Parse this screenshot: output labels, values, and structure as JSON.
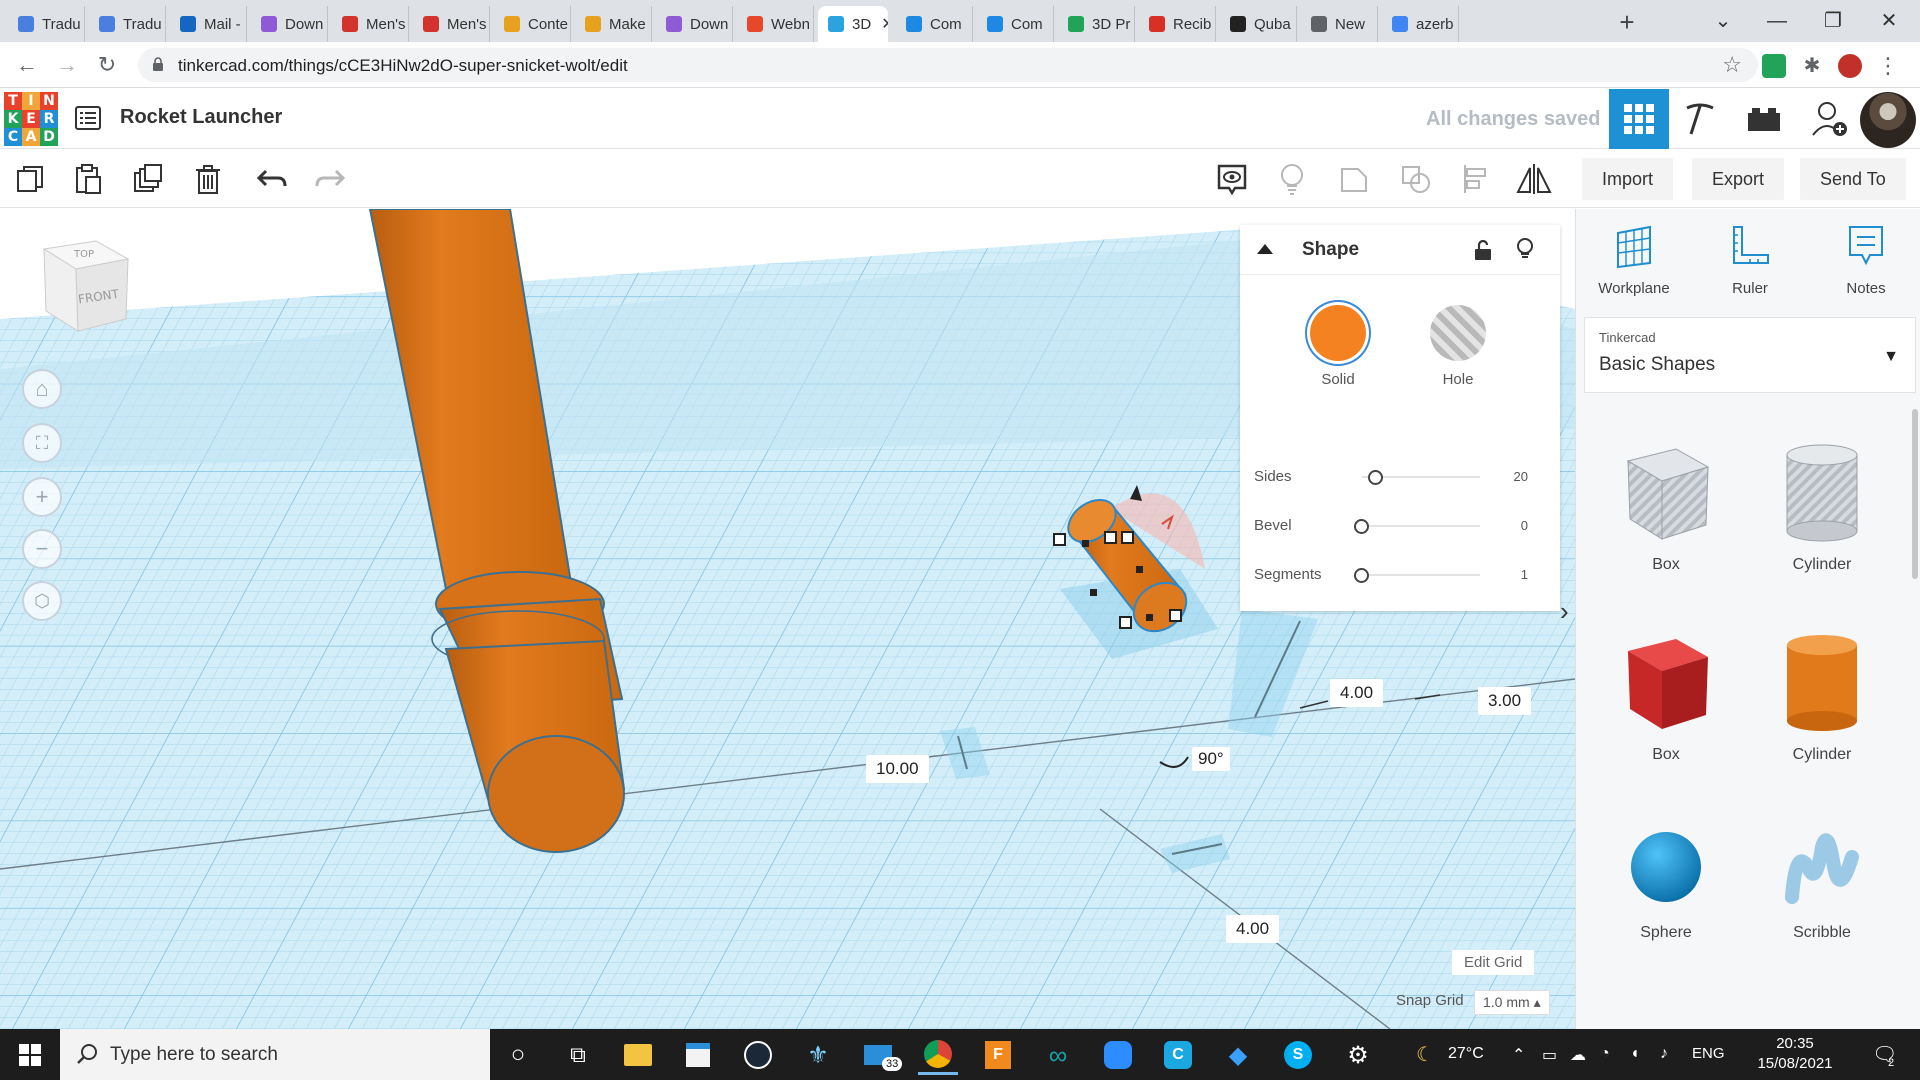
{
  "browser": {
    "tabs": [
      {
        "label": "Tradu",
        "color": "#4a7fe0"
      },
      {
        "label": "Tradu",
        "color": "#4a7fe0"
      },
      {
        "label": "Mail -",
        "color": "#1566c0"
      },
      {
        "label": "Down",
        "color": "#8e5bd6"
      },
      {
        "label": "Men's",
        "color": "#d4332d"
      },
      {
        "label": "Men's",
        "color": "#d4332d"
      },
      {
        "label": "Conte",
        "color": "#e6a21c"
      },
      {
        "label": "Make",
        "color": "#e6a21c"
      },
      {
        "label": "Down",
        "color": "#8e5bd6"
      },
      {
        "label": "Webn",
        "color": "#e8482a"
      },
      {
        "label": "3D",
        "color": "#2aa3e0",
        "active": true
      },
      {
        "label": "Com",
        "color": "#1e88e5"
      },
      {
        "label": "Com",
        "color": "#1e88e5"
      },
      {
        "label": "3D Pr",
        "color": "#22a35a"
      },
      {
        "label": "Recib",
        "color": "#d93025"
      },
      {
        "label": "Quba",
        "color": "#222222"
      },
      {
        "label": "New",
        "color": "#5f6368"
      },
      {
        "label": "azerb",
        "color": "#4285f4"
      }
    ],
    "url": "tinkercad.com/things/cCE3HiNw2dO-super-snicket-wolt/edit"
  },
  "header": {
    "logo_letters": [
      "T",
      "I",
      "N",
      "K",
      "E",
      "R",
      "C",
      "A",
      "D"
    ],
    "logo_colors": [
      "#e8412c",
      "#f2a63a",
      "#e8412c",
      "#22a35a",
      "#e8412c",
      "#1f8fd6",
      "#1f8fd6",
      "#f2a63a",
      "#22a35a"
    ],
    "project_title": "Rocket Launcher",
    "save_status": "All changes saved"
  },
  "toolbar": {
    "import": "Import",
    "export": "Export",
    "send_to": "Send To"
  },
  "viewcube": {
    "top": "TOP",
    "front": "FRONT"
  },
  "dimensions": {
    "height_value": "10.00",
    "width_value": "4.00",
    "depth_value": "3.00",
    "length_value": "4.00",
    "rotation": "90°"
  },
  "inspector": {
    "title": "Shape",
    "solid": "Solid",
    "hole": "Hole",
    "solid_color": "#f58220",
    "props": [
      {
        "name": "Sides",
        "value": "20"
      },
      {
        "name": "Bevel",
        "value": "0"
      },
      {
        "name": "Segments",
        "value": "1"
      }
    ]
  },
  "rightpanel": {
    "tools": [
      "Workplane",
      "Ruler",
      "Notes"
    ],
    "library_category": "Tinkercad",
    "library_name": "Basic Shapes",
    "shapes": [
      "Box",
      "Cylinder",
      "Box",
      "Cylinder",
      "Sphere",
      "Scribble"
    ]
  },
  "grid": {
    "edit_grid": "Edit Grid",
    "snap_grid": "Snap Grid",
    "snap_value": "1.0 mm ▴"
  },
  "taskbar": {
    "search_placeholder": "Type here to search",
    "mail_badge": "33",
    "temperature": "27°C",
    "language": "ENG",
    "time": "20:35",
    "date": "15/08/2021",
    "notif_count": "2"
  },
  "colors": {
    "accent": "#1e90d4",
    "orange": "#e37b1c",
    "grid_blue": "#b7e1f3"
  }
}
